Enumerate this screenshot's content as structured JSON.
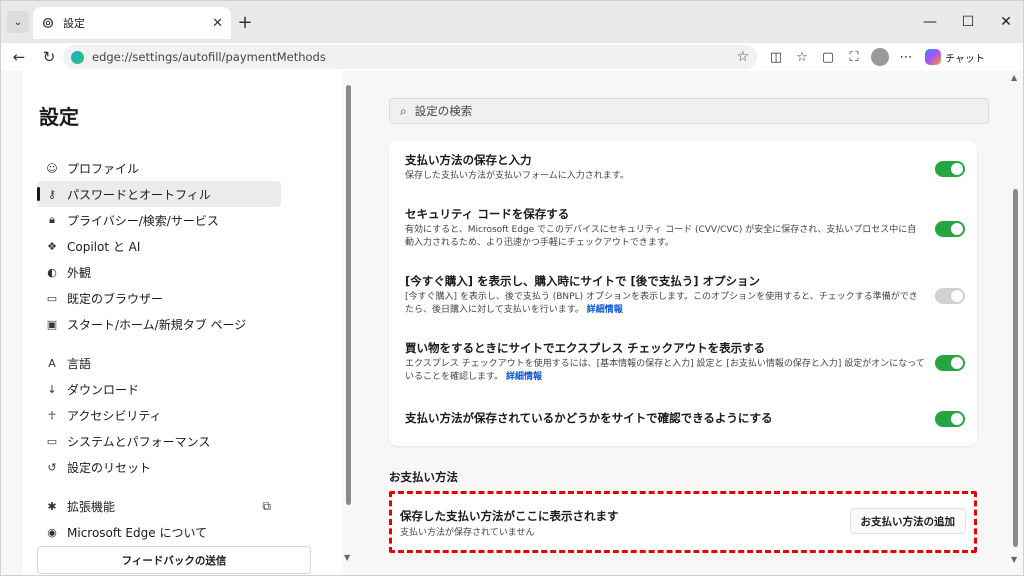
{
  "tab": {
    "title": "設定",
    "close": "✕"
  },
  "window": {
    "minimize": "—",
    "maximize": "☐",
    "close": "✕"
  },
  "address": {
    "url": "edge://settings/autofill/paymentMethods"
  },
  "toolbar": {
    "chat_label": "チャット"
  },
  "sidebar": {
    "title": "設定",
    "items": [
      {
        "label": "プロファイル",
        "icon": "person-icon"
      },
      {
        "label": "パスワードとオートフィル",
        "icon": "key-icon"
      },
      {
        "label": "プライバシー/検索/サービス",
        "icon": "lock-icon"
      },
      {
        "label": "Copilot と AI",
        "icon": "copilot-icon"
      },
      {
        "label": "外観",
        "icon": "palette-icon"
      },
      {
        "label": "既定のブラウザー",
        "icon": "browser-icon"
      },
      {
        "label": "スタート/ホーム/新規タブ ページ",
        "icon": "home-icon"
      },
      {
        "label": "言語",
        "icon": "language-icon"
      },
      {
        "label": "ダウンロード",
        "icon": "download-icon"
      },
      {
        "label": "アクセシビリティ",
        "icon": "accessibility-icon"
      },
      {
        "label": "システムとパフォーマンス",
        "icon": "laptop-icon"
      },
      {
        "label": "設定のリセット",
        "icon": "reset-icon"
      },
      {
        "label": "拡張機能",
        "icon": "extensions-icon"
      },
      {
        "label": "Microsoft Edge について",
        "icon": "edge-icon"
      }
    ],
    "feedback": "フィードバックの送信"
  },
  "search": {
    "placeholder": "設定の検索"
  },
  "settings": [
    {
      "title": "支払い方法の保存と入力",
      "desc": "保存した支払い方法が支払いフォームに入力されます。",
      "enabled": true
    },
    {
      "title": "セキュリティ コードを保存する",
      "desc": "有効にすると、Microsoft Edge でこのデバイスにセキュリティ コード (CVV/CVC) が安全に保存され、支払いプロセス中に自動入力されるため、より迅速かつ手軽にチェックアウトできます。",
      "enabled": true
    },
    {
      "title": "[今すぐ購入] を表示し、購入時にサイトで [後で支払う] オプション",
      "desc": "[今すぐ購入] を表示し、後で支払う (BNPL) オプションを表示します。このオプションを使用すると、チェックする準備ができたら、後日購入に対して支払いを行います。",
      "link": "詳細情報",
      "enabled": false
    },
    {
      "title": "買い物をするときにサイトでエクスプレス チェックアウトを表示する",
      "desc": "エクスプレス チェックアウトを使用するには、[基本情報の保存と入力] 設定と [お支払い情報の保存と入力] 設定がオンになっていることを確認します。",
      "link": "詳細情報",
      "enabled": true
    },
    {
      "title": "支払い方法が保存されているかどうかをサイトで確認できるようにする",
      "desc": "",
      "enabled": true
    }
  ],
  "payment": {
    "section_title": "お支払い方法",
    "card_title": "保存した支払い方法がここに表示されます",
    "card_desc": "支払い方法が保存されていません",
    "add_button": "お支払い方法の追加"
  },
  "colors": {
    "toggle_on": "#26a541",
    "highlight": "#e60000",
    "link": "#0b57d0"
  }
}
